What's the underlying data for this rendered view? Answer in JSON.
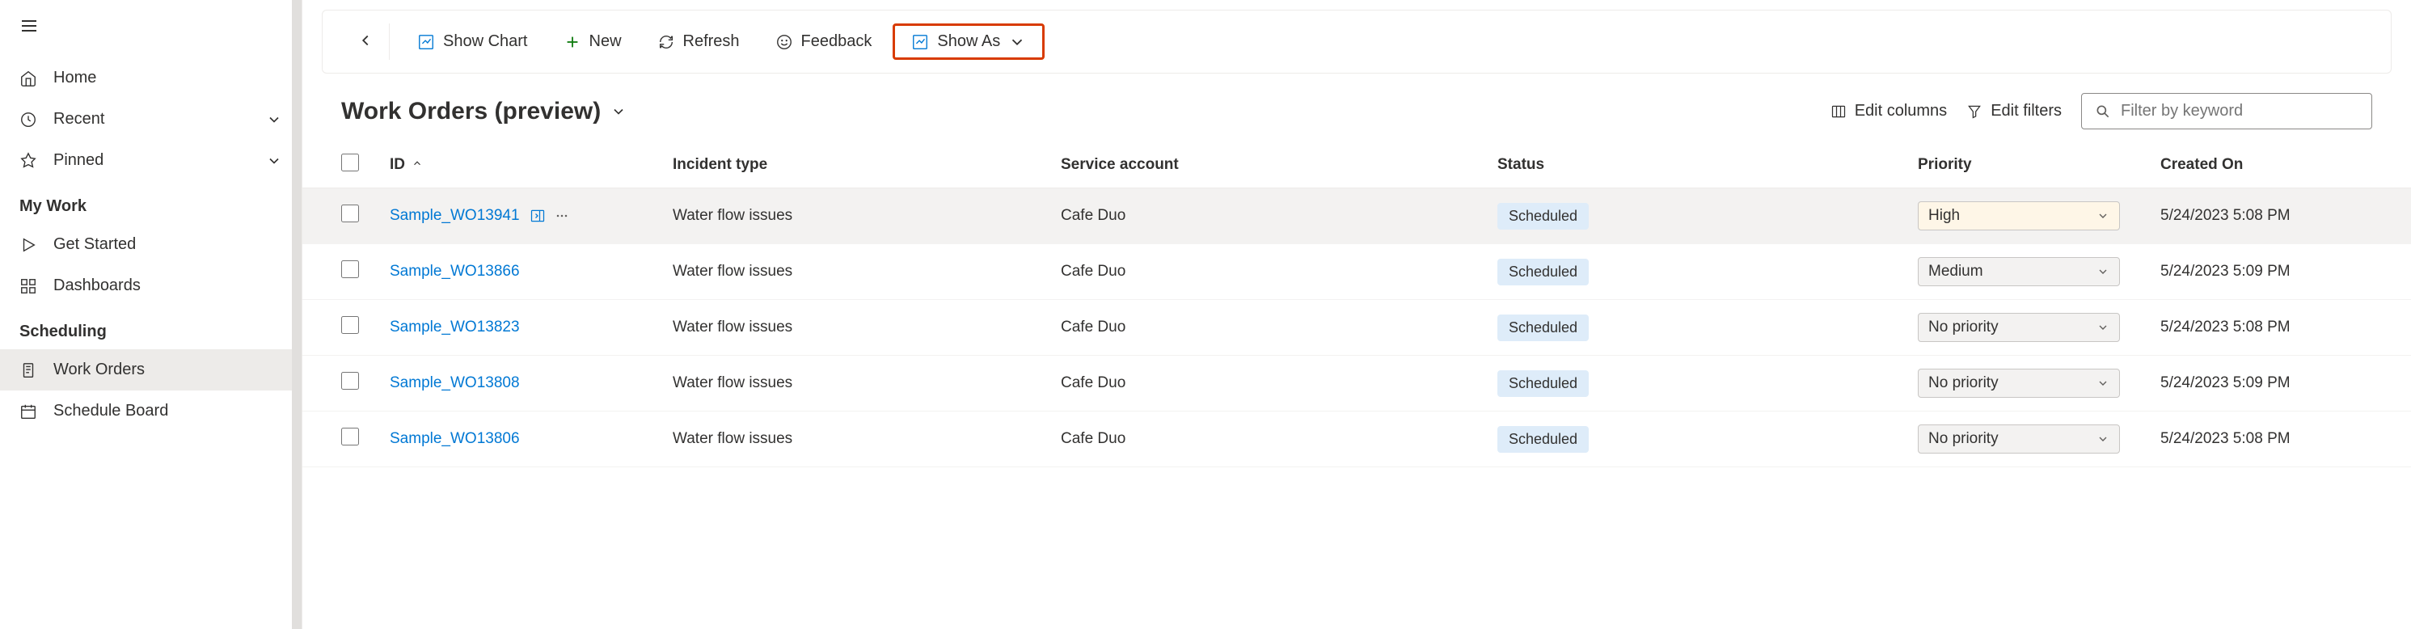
{
  "sidebar": {
    "nav": {
      "home": "Home",
      "recent": "Recent",
      "pinned": "Pinned"
    },
    "sections": {
      "mywork": {
        "label": "My Work",
        "items": {
          "getstarted": "Get Started",
          "dashboards": "Dashboards"
        }
      },
      "scheduling": {
        "label": "Scheduling",
        "items": {
          "workorders": "Work Orders",
          "scheduleboard": "Schedule Board"
        }
      }
    }
  },
  "toolbar": {
    "showchart": "Show Chart",
    "new": "New",
    "refresh": "Refresh",
    "feedback": "Feedback",
    "showas": "Show As"
  },
  "view": {
    "title": "Work Orders (preview)",
    "editcolumns": "Edit columns",
    "editfilters": "Edit filters",
    "filter_placeholder": "Filter by keyword"
  },
  "grid": {
    "headers": {
      "id": "ID",
      "incident": "Incident type",
      "service": "Service account",
      "status": "Status",
      "priority": "Priority",
      "created": "Created On"
    },
    "rows": [
      {
        "id": "Sample_WO13941",
        "incident": "Water flow issues",
        "service": "Cafe Duo",
        "status": "Scheduled",
        "priority": "High",
        "created": "5/24/2023 5:08 PM",
        "hovered": true
      },
      {
        "id": "Sample_WO13866",
        "incident": "Water flow issues",
        "service": "Cafe Duo",
        "status": "Scheduled",
        "priority": "Medium",
        "created": "5/24/2023 5:09 PM",
        "hovered": false
      },
      {
        "id": "Sample_WO13823",
        "incident": "Water flow issues",
        "service": "Cafe Duo",
        "status": "Scheduled",
        "priority": "No priority",
        "created": "5/24/2023 5:08 PM",
        "hovered": false
      },
      {
        "id": "Sample_WO13808",
        "incident": "Water flow issues",
        "service": "Cafe Duo",
        "status": "Scheduled",
        "priority": "No priority",
        "created": "5/24/2023 5:09 PM",
        "hovered": false
      },
      {
        "id": "Sample_WO13806",
        "incident": "Water flow issues",
        "service": "Cafe Duo",
        "status": "Scheduled",
        "priority": "No priority",
        "created": "5/24/2023 5:08 PM",
        "hovered": false
      }
    ]
  }
}
